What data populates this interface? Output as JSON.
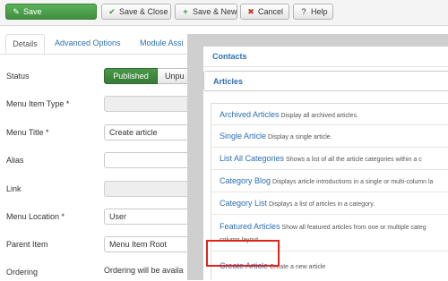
{
  "toolbar": {
    "save": "Save",
    "save_close": "Save & Close",
    "save_new": "Save & New",
    "cancel": "Cancel",
    "help": "Help"
  },
  "tabs": [
    {
      "label": "Details"
    },
    {
      "label": "Advanced Options"
    },
    {
      "label": "Module Assi"
    }
  ],
  "form": {
    "status_label": "Status",
    "published": "Published",
    "unpublished_partial": "Unpu",
    "menu_item_type_label": "Menu Item Type *",
    "menu_title_label": "Menu Title *",
    "menu_title_value": "Create article",
    "alias_label": "Alias",
    "link_label": "Link",
    "menu_location_label": "Menu Location *",
    "menu_location_value": "User",
    "parent_item_label": "Parent Item",
    "parent_item_value": "Menu Item Root",
    "ordering_label": "Ordering",
    "ordering_note": "Ordering will be availa"
  },
  "modal": {
    "contacts": "Contacts",
    "articles": "Articles",
    "items": [
      {
        "title": "Archived Articles",
        "desc": "Display all archived articles."
      },
      {
        "title": "Single Article",
        "desc": "Display a single article."
      },
      {
        "title": "List All Categories",
        "desc": "Shows a list of all the article categories within a c"
      },
      {
        "title": "Category Blog",
        "desc": "Displays article introductions in a single or multi-column la"
      },
      {
        "title": "Category List",
        "desc": "Displays a list of articles in a category."
      },
      {
        "title": "Featured Articles",
        "desc": "Show all featured articles from one or multiple categ",
        "desc2": "column layout."
      },
      {
        "title": "Create Article",
        "desc": "Create a new article"
      }
    ]
  },
  "colors": {
    "link_blue": "#2a6fb3",
    "save_green": "#3f8f3f",
    "highlight_red": "#e0241b"
  }
}
